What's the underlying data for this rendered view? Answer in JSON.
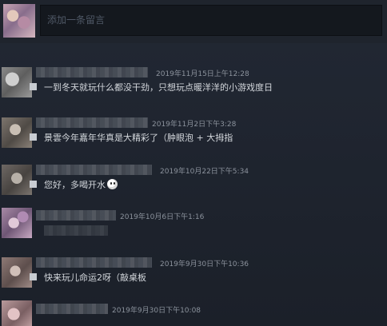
{
  "composer": {
    "placeholder": "添加一条留言"
  },
  "comments": [
    {
      "timestamp": "2019年11月15日上午12:28",
      "text": "一到冬天就玩什么都没干劲，只想玩点暖洋洋的小游戏度日",
      "emoji": ""
    },
    {
      "timestamp": "2019年11月2日下午3:28",
      "text": "景雲今年嘉年华真是大精彩了（肿眼泡 + 大拇指",
      "emoji": ""
    },
    {
      "timestamp": "2019年10月22日下午5:34",
      "text": "您好，多喝开水",
      "emoji": "smiley-emoji"
    },
    {
      "timestamp": "2019年10月6日下午1:16",
      "text": "",
      "emoji": ""
    },
    {
      "timestamp": "2019年9月30日下午10:36",
      "text": "快来玩儿命运2呀（敲桌板",
      "emoji": ""
    },
    {
      "timestamp": "2019年9月30日下午10:08",
      "text": "",
      "emoji": ""
    }
  ]
}
